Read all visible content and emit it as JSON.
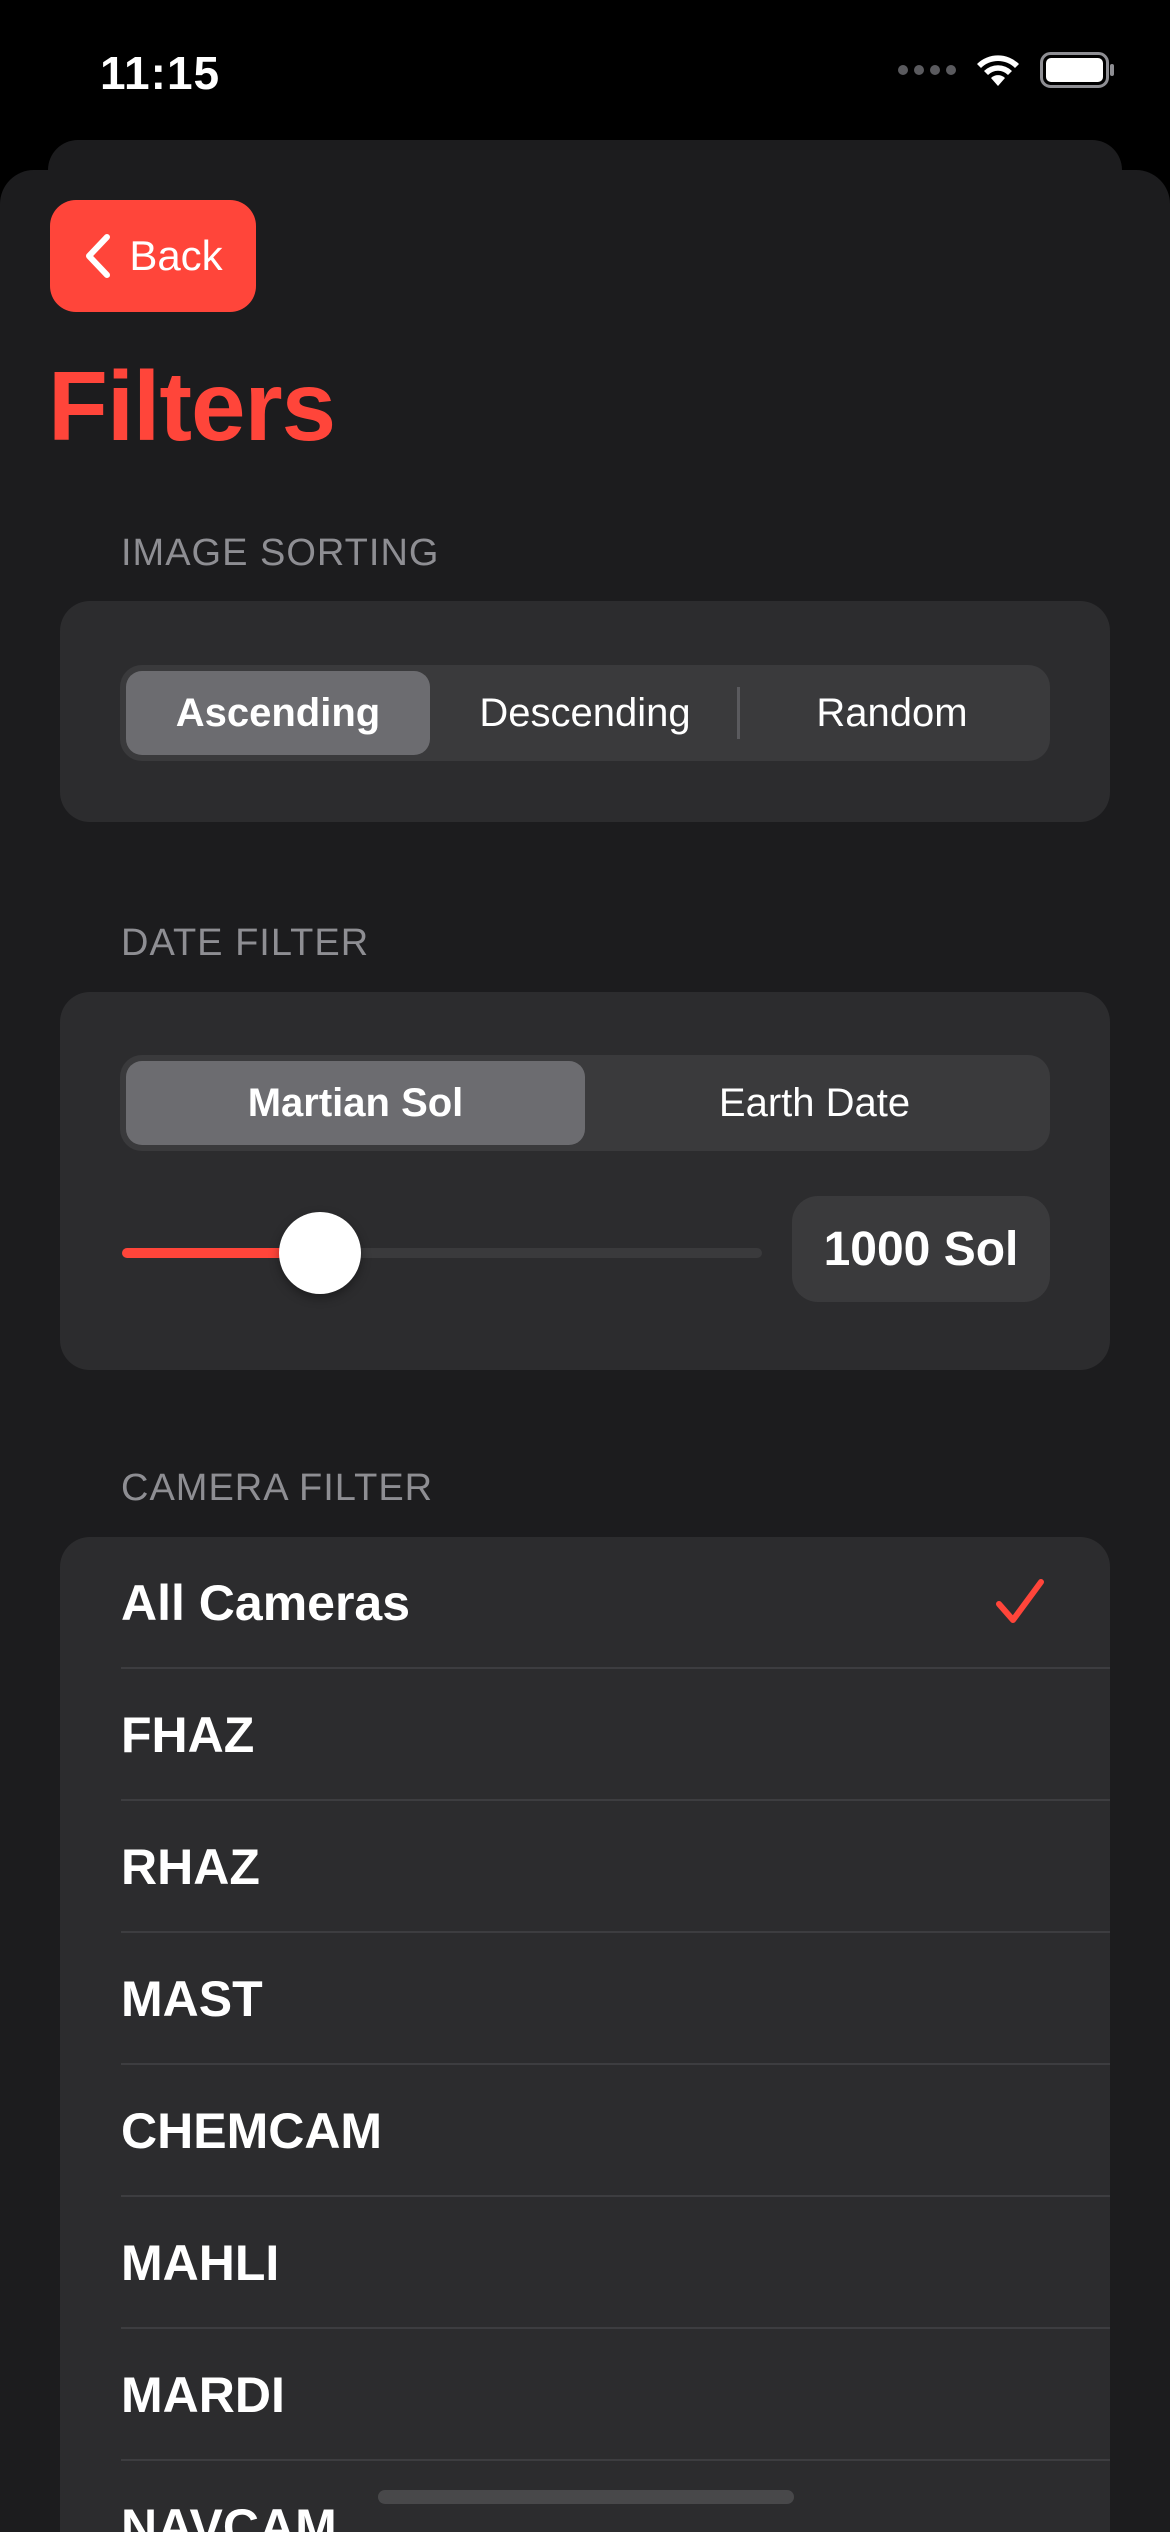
{
  "status_bar": {
    "time": "11:15"
  },
  "navigation": {
    "back_label": "Back",
    "title": "Filters"
  },
  "image_sorting": {
    "header": "IMAGE SORTING",
    "options": [
      "Ascending",
      "Descending",
      "Random"
    ],
    "selected": "Ascending"
  },
  "date_filter": {
    "header": "DATE FILTER",
    "options": [
      "Martian Sol",
      "Earth Date"
    ],
    "selected": "Martian Sol",
    "slider_fraction": 0.31,
    "value_label": "1000 Sol"
  },
  "camera_filter": {
    "header": "CAMERA FILTER",
    "items": [
      "All Cameras",
      "FHAZ",
      "RHAZ",
      "MAST",
      "CHEMCAM",
      "MAHLI",
      "MARDI",
      "NAVCAM"
    ],
    "selected": "All Cameras"
  },
  "colors": {
    "accent": "#ff453a",
    "background": "#1c1c1e",
    "group_background": "#2c2c2e",
    "secondary_text": "#8e8e93"
  },
  "icons": {
    "back": "chevron-left-icon",
    "checkmark": "checkmark-icon",
    "wifi": "wifi-icon",
    "battery": "battery-icon",
    "signal": "cellular-signal-icon"
  }
}
